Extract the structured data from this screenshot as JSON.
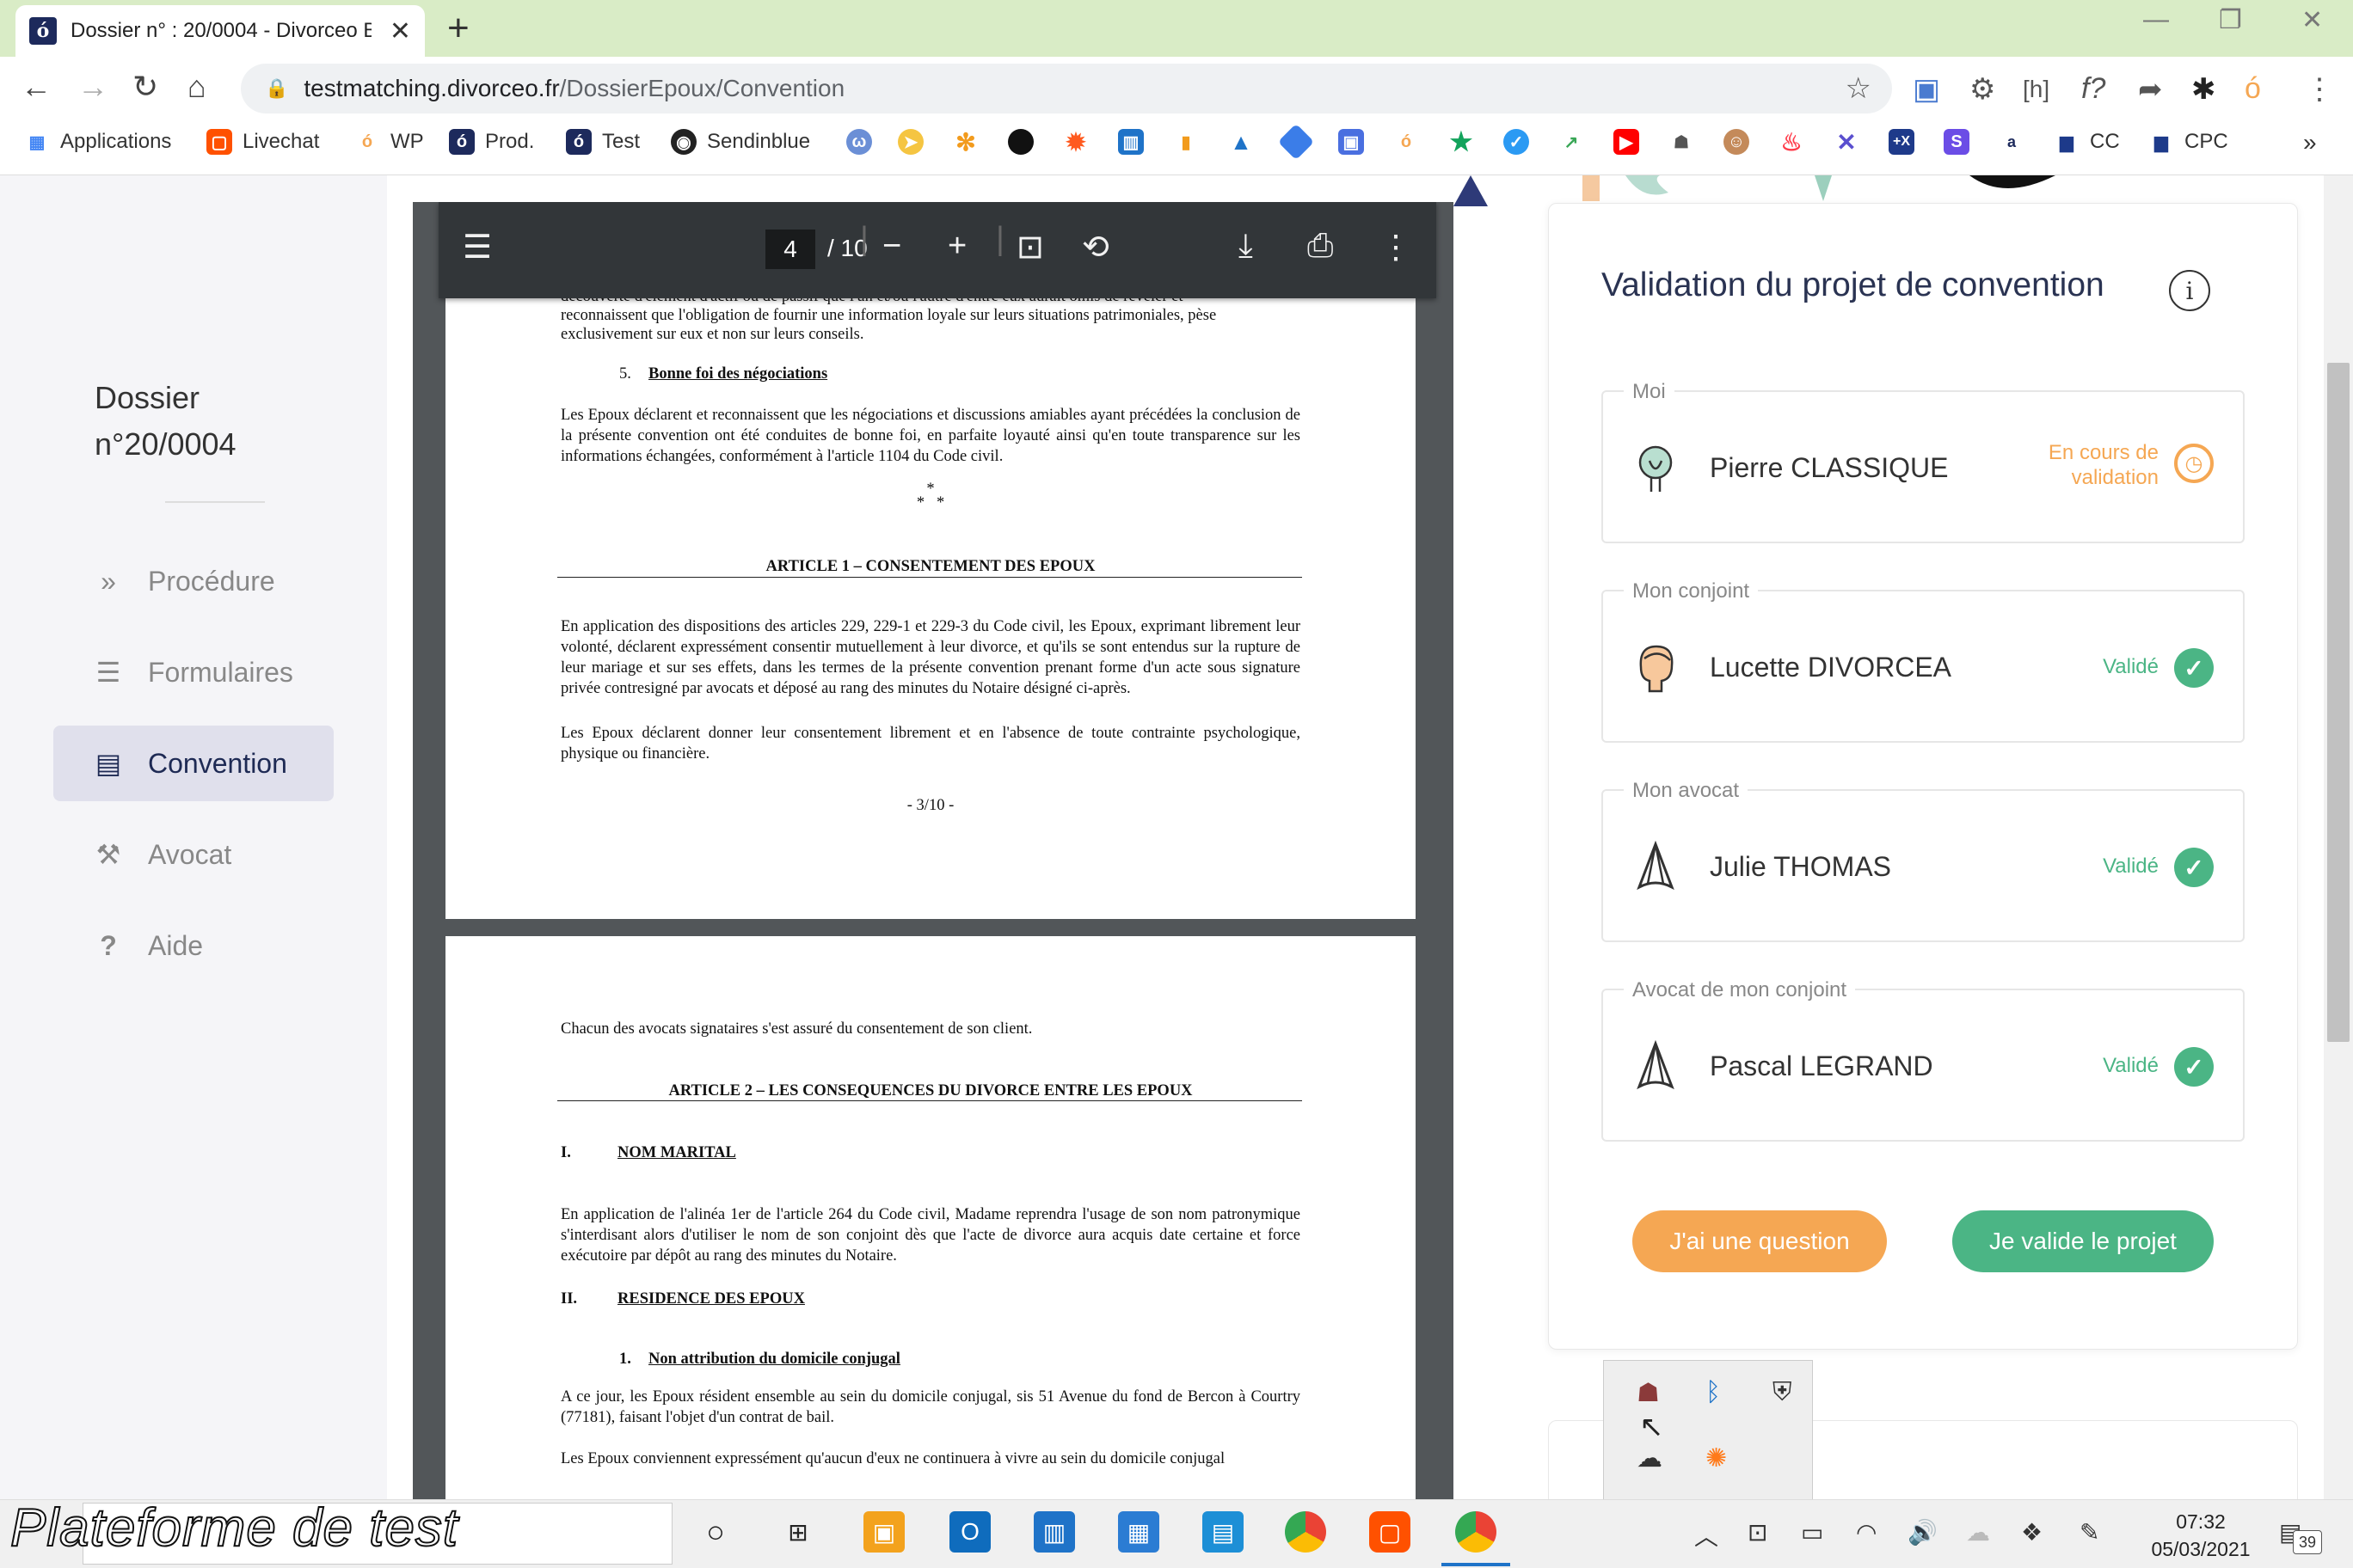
{
  "browser": {
    "tab_title": "Dossier n° : 20/0004 - Divorceo B",
    "url_host": "testmatching.divorceo.fr",
    "url_path": "/DossierEpoux/Convention",
    "bookmarks": [
      {
        "label": "Applications",
        "color": "#4285f4",
        "glyph": "▦"
      },
      {
        "label": "Livechat",
        "color": "#ff5100",
        "glyph": "▢"
      },
      {
        "label": "WP",
        "color": "#f5a753",
        "glyph": "ó"
      },
      {
        "label": "Prod.",
        "color": "#1d2a5c",
        "glyph": "ó"
      },
      {
        "label": "Test",
        "color": "#1d2a5c",
        "glyph": "ó"
      },
      {
        "label": "Sendinblue",
        "color": "#222222",
        "glyph": "◉"
      }
    ],
    "bookmark_right": [
      {
        "label": "CC",
        "color": "#1d3a8a",
        "glyph": "▆"
      },
      {
        "label": "CPC",
        "color": "#1d3a8a",
        "glyph": "▆"
      }
    ]
  },
  "sidebar": {
    "dossier_title": "Dossier n°20/0004",
    "items": [
      {
        "label": "Procédure",
        "icon": "double-chevron-icon",
        "glyph": "»"
      },
      {
        "label": "Formulaires",
        "icon": "list-icon",
        "glyph": "☰"
      },
      {
        "label": "Convention",
        "icon": "pdf-file-icon",
        "glyph": "▤"
      },
      {
        "label": "Avocat",
        "icon": "gavel-icon",
        "glyph": "⚒"
      },
      {
        "label": "Aide",
        "icon": "question-icon",
        "glyph": "?"
      }
    ]
  },
  "pdf": {
    "page_current": "4",
    "page_total": "/ 10",
    "page3": {
      "para_top_1": "découverte d'élément d'actif ou de passif que l'un et/ou l'autre d'entre eux aurait omis de révéler et",
      "para_top_2": "reconnaissent que l'obligation de fournir une information loyale sur leurs situations patrimoniales, pèse",
      "para_top_3": "exclusivement sur eux et non sur leurs conseils.",
      "heading5_num": "5.",
      "heading5": "Bonne foi des négociations",
      "para5": "Les Epoux déclarent et reconnaissent que les négociations et discussions amiables ayant précédées la conclusion de la présente convention ont été conduites de bonne foi, en parfaite loyauté ainsi qu'en toute transparence sur les informations échangées, conformément à l'article 1104 du Code civil.",
      "stars_1": "*",
      "stars_2": "*   *",
      "article1": "ARTICLE 1 – CONSENTEMENT DES EPOUX",
      "para_a1": "En application des dispositions des articles 229, 229-1 et 229-3 du Code civil, les Epoux, exprimant librement leur volonté, déclarent expressément consentir mutuellement à leur divorce, et qu'ils se sont entendus sur la rupture de leur mariage et sur ses effets, dans les termes de la présente convention prenant forme d'un acte sous signature privée contresigné par avocats et déposé au rang des minutes du Notaire désigné ci-après.",
      "para_a1b": "Les Epoux déclarent donner leur consentement librement et en l'absence de toute contrainte psychologique, physique ou financière.",
      "footer": "- 3/10 -"
    },
    "page4": {
      "para_1": "Chacun des avocats signataires s'est assuré du consentement de son client.",
      "article2": "ARTICLE 2 – LES CONSEQUENCES DU DIVORCE ENTRE LES EPOUX",
      "sec1_num": "I.",
      "sec1": "NOM MARITAL",
      "para_nom": "En application de l'alinéa 1er de l'article 264 du Code civil, Madame reprendra l'usage de son nom patronymique s'interdisant alors d'utiliser le nom de son conjoint dès que l'acte de divorce aura acquis date certaine et force exécutoire par dépôt au rang des minutes du Notaire.",
      "sec2_num": "II.",
      "sec2": "RESIDENCE DES EPOUX",
      "sub1_num": "1.",
      "sub1": "Non attribution du domicile conjugal",
      "para_res": "A ce jour, les Epoux résident ensemble au sein du domicile conjugal, sis 51 Avenue du fond de Bercon à Courtry (77181), faisant l'objet d'un contrat de bail.",
      "para_res2": "Les Epoux conviennent expressément qu'aucun d'eux ne continuera à vivre au sein du domicile conjugal"
    }
  },
  "validation": {
    "title": "Validation du projet de convention",
    "info_glyph": "i",
    "parties": [
      {
        "legend": "Moi",
        "name": "Pierre CLASSIQUE",
        "status": "En cours de validation",
        "state": "pending"
      },
      {
        "legend": "Mon conjoint",
        "name": "Lucette DIVORCEA",
        "status": "Validé",
        "state": "ok"
      },
      {
        "legend": "Mon avocat",
        "name": "Julie THOMAS",
        "status": "Validé",
        "state": "ok"
      },
      {
        "legend": "Avocat de mon conjoint",
        "name": "Pascal LEGRAND",
        "status": "Validé",
        "state": "ok"
      }
    ],
    "btn_question": "J'ai une question",
    "btn_validate": "Je valide le projet",
    "next_card_partial": "...",
    "colors": {
      "pending": "#f5a753",
      "ok": "#4bb585",
      "question_btn": "#f5a753",
      "validate_btn": "#4bb585"
    }
  },
  "taskbar": {
    "watermark": "Plateforme de test",
    "time": "07:32",
    "date": "05/03/2021",
    "notif_count": "39"
  }
}
